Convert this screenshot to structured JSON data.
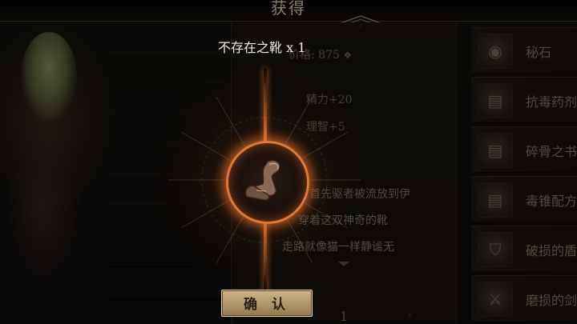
{
  "header": {
    "title": "获得"
  },
  "reward": {
    "item_name": "不存在之靴 x 1",
    "confirm_label": "确 认"
  },
  "details": {
    "price_label": "价格: 875",
    "currency_icon": "coin-icon",
    "stats": [
      "精力+20",
      "理智+5"
    ],
    "description_lines": [
      "首先驱者被流放到伊",
      "穿着这双神奇的靴",
      "走路就像猫一样静谧无"
    ],
    "quantity": "1"
  },
  "inventory": {
    "items": [
      {
        "label": "秘石",
        "icon": "stone-icon"
      },
      {
        "label": "抗毒药剂",
        "icon": "scroll-icon"
      },
      {
        "label": "碎骨之书",
        "icon": "scroll-icon"
      },
      {
        "label": "毒锥配方",
        "icon": "scroll-icon"
      },
      {
        "label": "破损的盾牌",
        "icon": "shield-icon"
      },
      {
        "label": "磨损的剑",
        "icon": "sword-icon"
      }
    ]
  },
  "colors": {
    "accent_orange": "#e07a32",
    "button_gold": "#c2a97b",
    "text_light": "#f1ead9"
  }
}
